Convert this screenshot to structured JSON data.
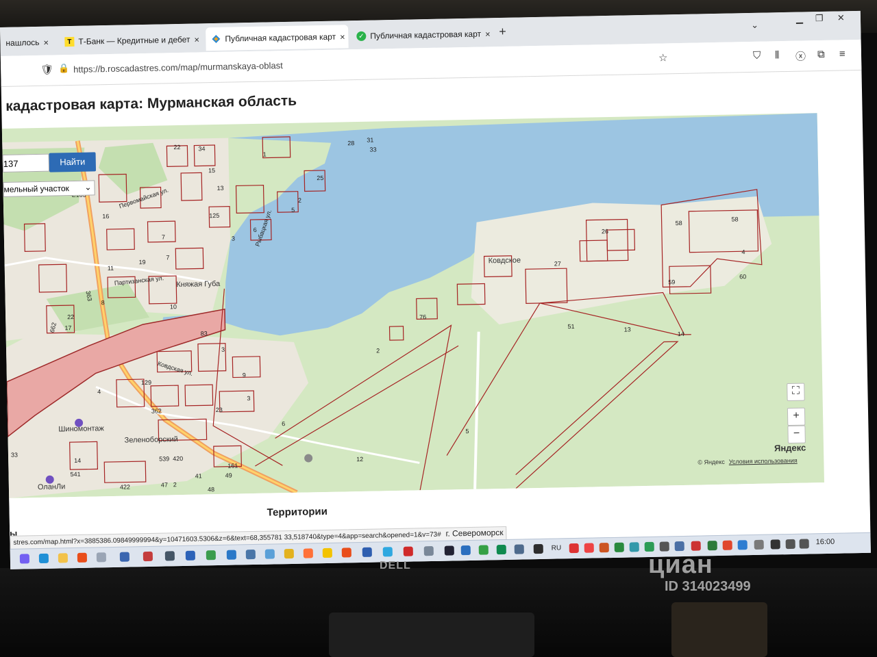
{
  "browser": {
    "tabs": [
      {
        "label": "нашлось",
        "favicon": "generic-icon"
      },
      {
        "label": "Т-Банк — Кредитные и дебет",
        "favicon": "t-bank-icon"
      },
      {
        "label": "Публичная кадастровая карт",
        "favicon": "rosreestr-icon",
        "active": true
      },
      {
        "label": "Публичная кадастровая карт",
        "favicon": "check-icon"
      }
    ],
    "new_tab": "+",
    "close": "×",
    "url": "https://b.roscadastres.com/map/murmanskaya-oblast"
  },
  "page": {
    "title": "кадастровая карта: Мурманская область",
    "search_value": "137",
    "search_button": "Найти",
    "object_type": "мельный участок",
    "territories": "Территории",
    "status_url": "stres.com/map.html?x=3885386.09849999994&y=10471603.5306&z=6&text=68,355781 33,518740&type=4&app=search&opened=1&v=73#",
    "city": "г. Североморск",
    "side_text": "ы"
  },
  "map": {
    "places": [
      "Княжая Губа",
      "Ковдское",
      "Зеленоборский",
      "Шиномонтаж",
      "ОланЛи"
    ],
    "streets": [
      "Первомайская ул.",
      "Рыбацкая ул.",
      "Ковдская ул.",
      "Партизанская ул."
    ],
    "roads": [
      "Е105",
      "363",
      "662",
      "83"
    ],
    "parcel_numbers": [
      "22",
      "34",
      "1",
      "28",
      "31",
      "33",
      "13",
      "15",
      "25",
      "2",
      "5",
      "16",
      "125",
      "6",
      "3",
      "8",
      "10",
      "11",
      "19",
      "7",
      "22",
      "17",
      "4",
      "7",
      "76",
      "2",
      "51",
      "13",
      "58",
      "58",
      "4",
      "60",
      "59",
      "14",
      "26",
      "27",
      "6",
      "5",
      "12",
      "539",
      "420",
      "41",
      "49",
      "161",
      "422",
      "47",
      "2",
      "48",
      "362",
      "23",
      "3",
      "9",
      "129",
      "3",
      "33",
      "14",
      "541"
    ],
    "zoom_in": "+",
    "zoom_out": "−",
    "provider": "Яндекс",
    "copyright": "© Яндекс",
    "terms": "Условия использования"
  },
  "taskbar": {
    "lang": "RU",
    "time": "16:00"
  },
  "bezel": {
    "brand": "DELL"
  },
  "watermark": {
    "logo": "циан",
    "id": "ID 314023499"
  }
}
